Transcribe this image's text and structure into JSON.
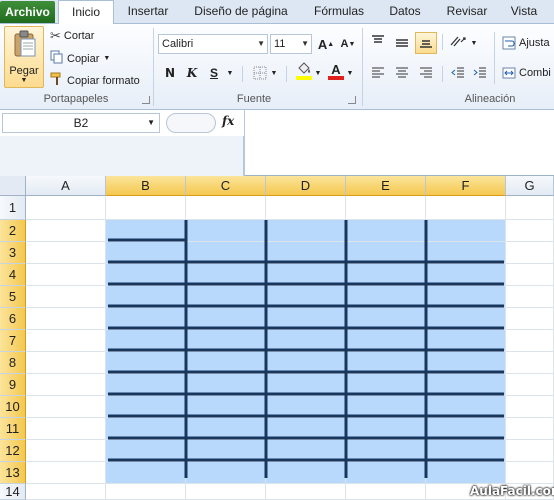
{
  "tabs": {
    "file": "Archivo",
    "items": [
      "Inicio",
      "Insertar",
      "Diseño de página",
      "Fórmulas",
      "Datos",
      "Revisar",
      "Vista"
    ]
  },
  "clipboard": {
    "paste": "Pegar",
    "cut": "Cortar",
    "copy": "Copiar",
    "format_painter": "Copiar formato",
    "label": "Portapapeles"
  },
  "font": {
    "name": "Calibri",
    "size": "11",
    "bold": "N",
    "italic": "K",
    "underline": "S",
    "grow": "A",
    "shrink": "A",
    "color_letter": "A",
    "label": "Fuente"
  },
  "alignment": {
    "wrap": "Ajusta",
    "merge": "Combi",
    "label": "Alineación"
  },
  "formula_bar": {
    "name_box": "B2",
    "fx": "fx"
  },
  "sheet": {
    "columns": [
      "A",
      "B",
      "C",
      "D",
      "E",
      "F",
      "G"
    ],
    "rows": [
      "1",
      "2",
      "3",
      "4",
      "5",
      "6",
      "7",
      "8",
      "9",
      "10",
      "11",
      "12",
      "13",
      "14"
    ],
    "selected_columns": [
      "B",
      "C",
      "D",
      "E",
      "F"
    ],
    "selected_rows": [
      "2",
      "3",
      "4",
      "5",
      "6",
      "7",
      "8",
      "9",
      "10",
      "11",
      "12",
      "13"
    ],
    "fill_color": "#b8d9fc",
    "border_color": "#17375e"
  },
  "watermark": "AulaFacil.com"
}
